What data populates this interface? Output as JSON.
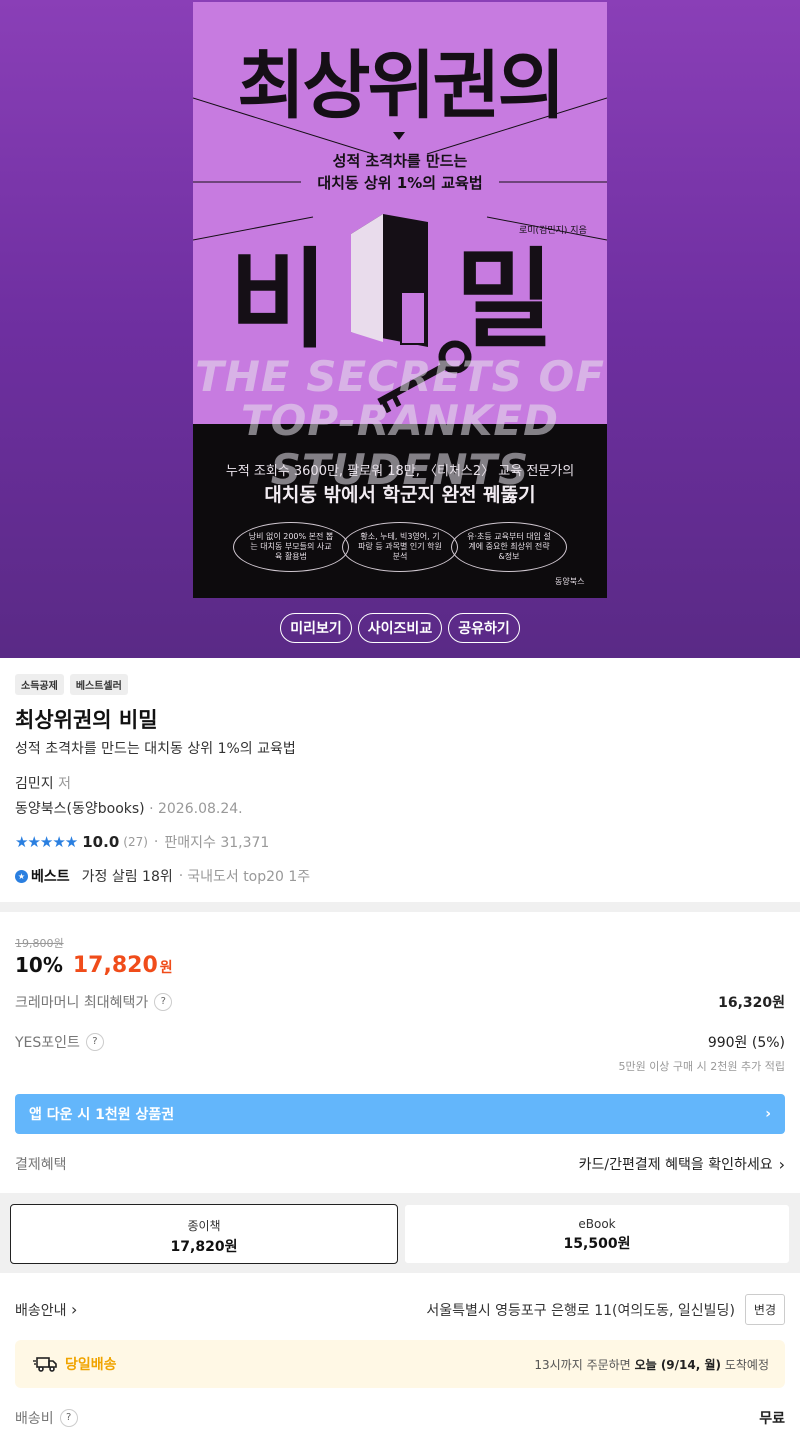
{
  "cover": {
    "title": "최상위권의",
    "subtitle_line1": "성적 초격차를 만드는",
    "subtitle_line2": "대치동 상위 1%의 교육법",
    "author_credit": "로미(김민지) 지음",
    "big_left": "비",
    "big_right": "밀",
    "english_line1": "THE SECRETS OF",
    "english_line2": "TOP-RANKED STUDENTS",
    "tagline1": "누적 조회수 3600만, 팔로워 18만, 〈티처스2〉 교육 전문가의",
    "tagline2": "대치동 밖에서 학군지 완전 꿰뚫기",
    "oval1": "낭비 없이 200% 본전 뽑는 대치동 부모들의 사교육 활용법",
    "oval2": "황소, 누테, 빅3영어, 기파랑 등 과목별 인기 학원 분석",
    "oval3": "유·초등 교육부터 대입 설계에 중요한 최상위 전략&정보",
    "publisher_logo": "동양북스"
  },
  "hero_buttons": [
    "미리보기",
    "사이즈비교",
    "공유하기"
  ],
  "badges": [
    "소득공제",
    "베스트셀러"
  ],
  "book": {
    "title": "최상위권의 비밀",
    "subtitle": "성적 초격차를 만드는 대치동 상위 1%의 교육법",
    "author": "김민지",
    "author_role": "저",
    "publisher": "동양북스(동양books)",
    "date": "2026.08.24."
  },
  "rating": {
    "stars": "★★★★★",
    "score": "10.0",
    "count": "(27)",
    "sales_label": "판매지수 31,371"
  },
  "best": {
    "label": "베스트",
    "rank": "가정 살림 18위",
    "extra": "국내도서 top20 1주"
  },
  "price": {
    "original": "19,800원",
    "discount": "10%",
    "sale": "17,820",
    "won": "원"
  },
  "benefits": {
    "crema_label": "크레마머니 최대혜택가",
    "crema_value": "16,320원",
    "points_label": "YES포인트",
    "points_value": "990원 (5%)",
    "points_note": "5만원 이상 구매 시 2천원 추가 적립",
    "app_banner": "앱 다운 시 1천원 상품권",
    "payment_label": "결제혜택",
    "payment_link": "카드/간편결제 혜택을 확인하세요"
  },
  "formats": [
    {
      "label": "종이책",
      "price": "17,820원"
    },
    {
      "label": "eBook",
      "price": "15,500원"
    }
  ],
  "shipping": {
    "label": "배송안내",
    "address": "서울특별시 영등포구 은행로 11(여의도동, 일신빌딩)",
    "change": "변경",
    "sameday_label": "당일배송",
    "sameday_prefix": "13시까지 주문하면",
    "sameday_date": "오늘 (9/14, 월)",
    "sameday_suffix": "도착예정",
    "fee_label": "배송비",
    "fee_value": "무료"
  }
}
